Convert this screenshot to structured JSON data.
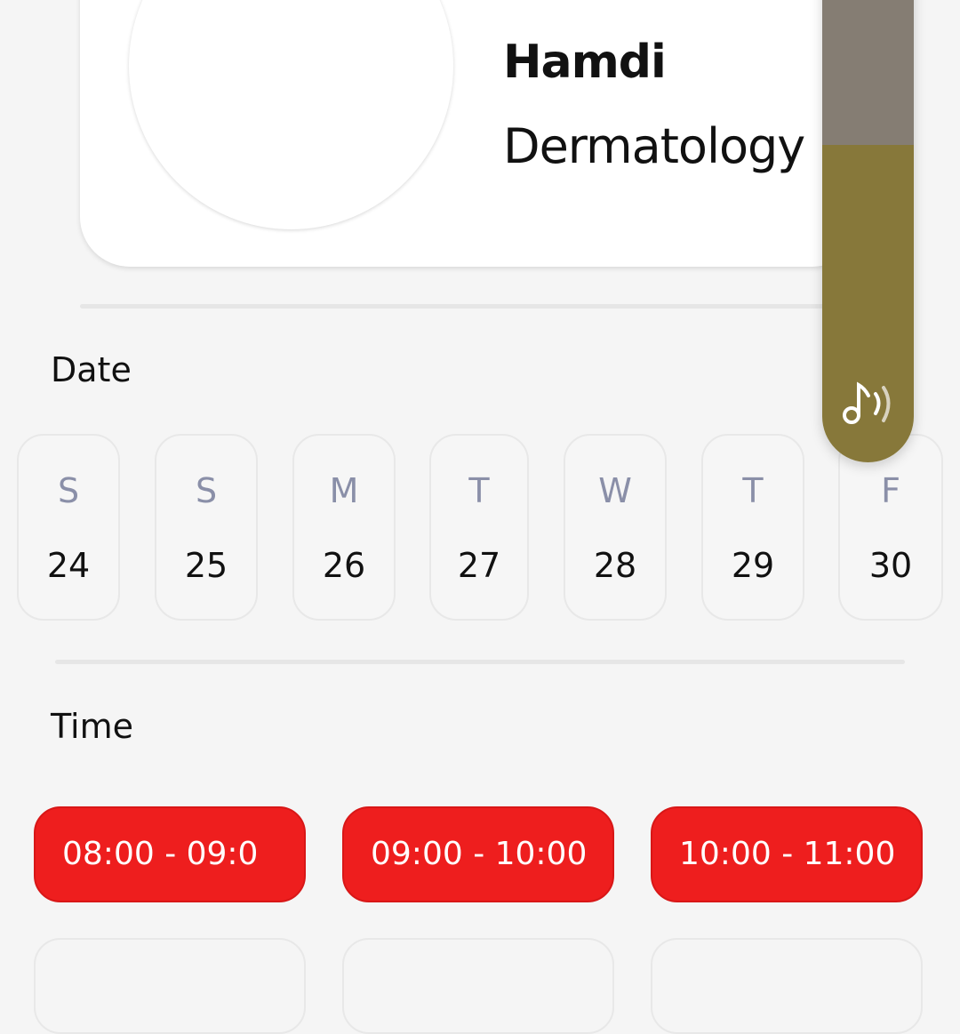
{
  "doctor": {
    "name": "Hamdi",
    "specialty": "Dermatology"
  },
  "date_section": {
    "label": "Date",
    "days": [
      {
        "dow": "S",
        "num": "24"
      },
      {
        "dow": "S",
        "num": "25"
      },
      {
        "dow": "M",
        "num": "26"
      },
      {
        "dow": "T",
        "num": "27"
      },
      {
        "dow": "W",
        "num": "28"
      },
      {
        "dow": "T",
        "num": "29"
      },
      {
        "dow": "F",
        "num": "30"
      }
    ]
  },
  "time_section": {
    "label": "Time",
    "slots": [
      {
        "label": "08:00 - 09:0"
      },
      {
        "label": "09:00 - 10:00"
      },
      {
        "label": "10:00 - 11:00"
      }
    ]
  },
  "volume_overlay": {
    "icon": "music-note-volume-icon",
    "level": 0.62,
    "fill_color": "#87783a",
    "track_color": "#857d73"
  },
  "colors": {
    "accent": "#ee1e1e",
    "background": "#f5f5f5",
    "weekday_text": "#8a8fa8"
  }
}
